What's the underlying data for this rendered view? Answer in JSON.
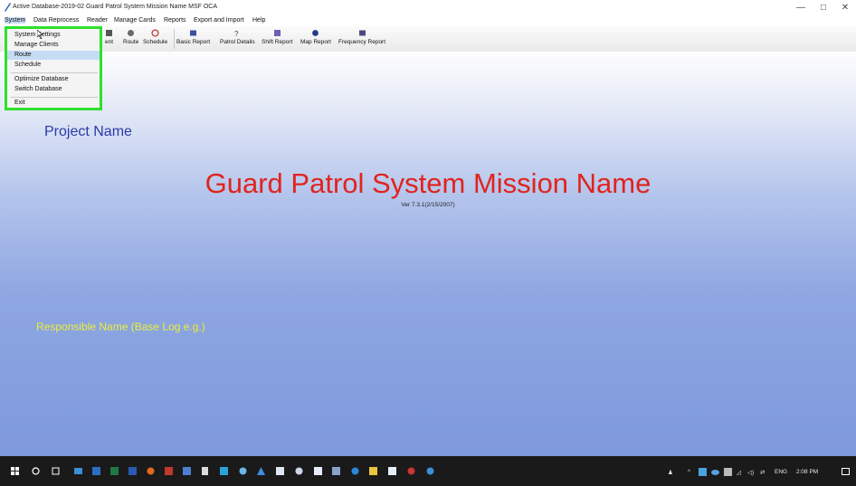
{
  "window": {
    "title": "Active Database-2019-02  Guard Patrol System Mission Name   MSF OCA",
    "minimize": "—",
    "maximize": "□",
    "close": "✕"
  },
  "menubar": {
    "items": [
      "System",
      "Data Reprocess",
      "Reader",
      "Manage Cards",
      "Reports",
      "Export and Import",
      "Help"
    ]
  },
  "toolbar": {
    "partial_label": "ent",
    "route": "Route",
    "schedule": "Schedule",
    "basic_report": "Basic Report",
    "patrol_details": "Patrol Details",
    "shift_report": "Shift Report",
    "map_report": "Map Report",
    "frequency_report": "Frequency Report"
  },
  "system_menu": {
    "items": [
      "System Settings",
      "Manage Clients",
      "Route",
      "Schedule",
      "Optimize Database",
      "Switch Database",
      "Exit"
    ],
    "highlighted": "Route"
  },
  "main": {
    "project_name": "Project Name",
    "heading": "Guard Patrol System Mission Name",
    "version": "Ver 7.3.1(2/15/2007)",
    "responsible": "Responsible Name (Base Log e.g.)"
  },
  "taskbar": {
    "language": "ENG",
    "time": "2:08 PM"
  },
  "colors": {
    "highlight_border": "#2ee02e",
    "heading": "#e0241e",
    "project": "#2b3aa8",
    "responsible": "#ecec3a"
  }
}
